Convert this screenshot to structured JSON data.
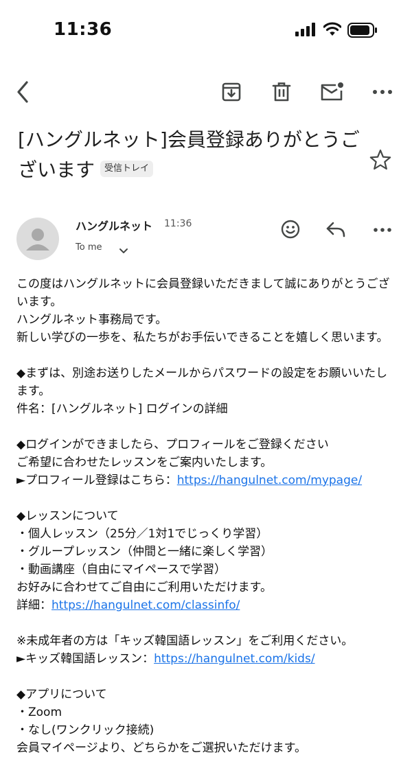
{
  "status_bar": {
    "time": "11:36"
  },
  "subject": {
    "title": "[ハングルネット]会員登録ありがとうございます",
    "label": "受信トレイ"
  },
  "sender": {
    "name": "ハングルネット",
    "time": "11:36",
    "to": "To me"
  },
  "body": {
    "p1a": "この度はハングルネットに会員登録いただきまして誠にありがとうございます。",
    "p1b": "ハングルネット事務局です。",
    "p1c": "新しい学びの一歩を、私たちがお手伝いできることを嬉しく思います。",
    "p2a": "◆まずは、別途お送りしたメールからパスワードの設定をお願いいたします。",
    "p2b": "件名：[ハングルネット] ログインの詳細",
    "p3a": "◆ログインができましたら、プロフィールをご登録ください",
    "p3b": "ご希望に合わせたレッスンをご案内いたします。",
    "p3c_prefix": "►プロフィール登録はこちら：",
    "p3c_link": "https://hangulnet.com/mypage/",
    "p4a": "◆レッスンについて",
    "p4b": "・個人レッスン（25分／1対1でじっくり学習）",
    "p4c": "・グループレッスン（仲間と一緒に楽しく学習）",
    "p4d": "・動画講座（自由にマイペースで学習）",
    "p4e": "お好みに合わせてご自由にご利用いただけます。",
    "p4f_prefix": "詳細：",
    "p4f_link": "https://hangulnet.com/classinfo/",
    "p5a": "※未成年者の方は「キッズ韓国語レッスン」をご利用ください。",
    "p5b_prefix": "►キッズ韓国語レッスン：",
    "p5b_link": "https://hangulnet.com/kids/",
    "p6a": "◆アプリについて",
    "p6b": "・Zoom",
    "p6c": "・なし(ワンクリック接続)",
    "p6d": "会員マイページより、どちらかをご選択いただけます。"
  },
  "icons": {
    "back": "back-arrow-icon",
    "archive": "archive-icon",
    "delete": "trash-icon",
    "unread": "mark-unread-icon",
    "more": "more-icon",
    "star": "star-icon",
    "emoji": "emoji-reaction-icon",
    "reply": "reply-icon"
  },
  "colors": {
    "link": "#1a73e8",
    "icon": "#444746"
  }
}
